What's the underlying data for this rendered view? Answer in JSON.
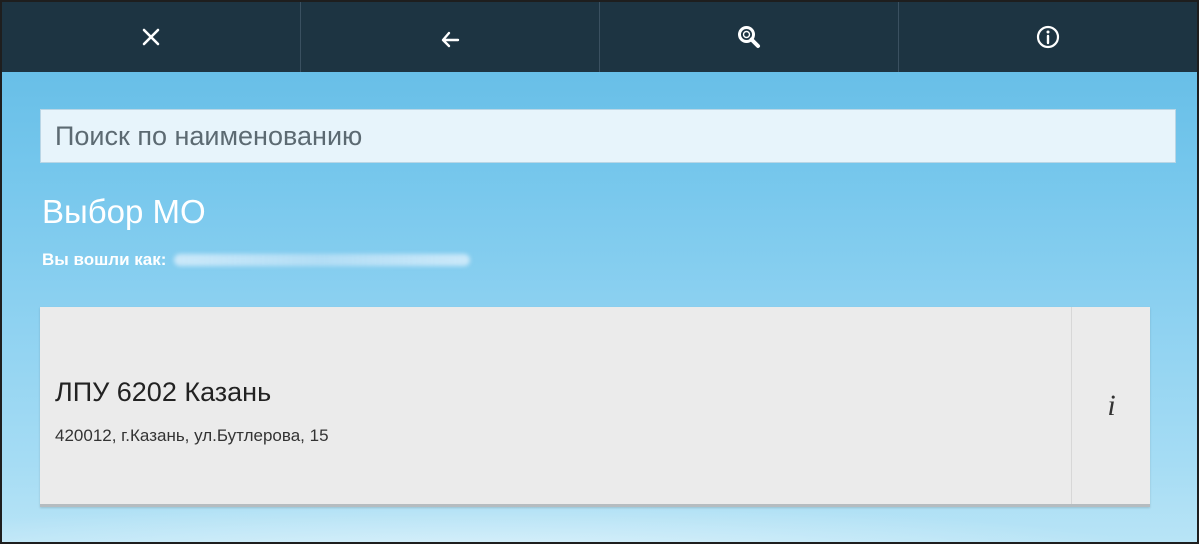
{
  "toolbar": {
    "buttons": [
      {
        "icon": "close-icon"
      },
      {
        "icon": "back-arrow-icon"
      },
      {
        "icon": "search-icon"
      },
      {
        "icon": "info-icon"
      }
    ],
    "background": "#1d3442"
  },
  "search": {
    "placeholder": "Поиск по наименованию",
    "value": ""
  },
  "page": {
    "title": "Выбор МО",
    "logged_in_label": "Вы вошли как:"
  },
  "organizations": [
    {
      "name": "ЛПУ 6202 Казань",
      "address": "420012, г.Казань, ул.Бутлерова, 15",
      "info_label": "i"
    }
  ],
  "colors": {
    "background_accent": "#74c6ec",
    "card_background": "#ebebeb"
  }
}
